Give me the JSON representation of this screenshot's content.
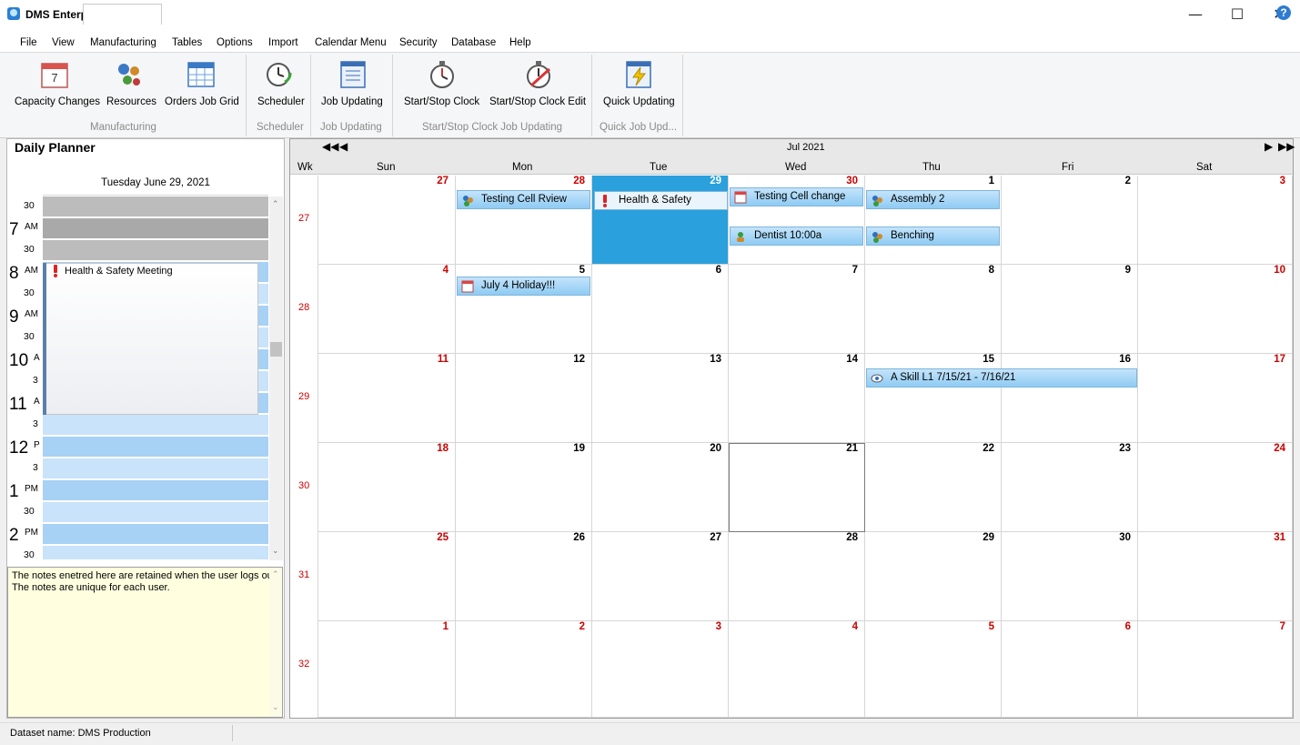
{
  "app": {
    "title": "DMS Enterprise",
    "window_controls": [
      "minimize",
      "maximize",
      "close"
    ]
  },
  "menu": {
    "items": [
      "File",
      "View",
      "Manufacturing",
      "Tables",
      "Options",
      "Import",
      "Calendar Menu",
      "Security",
      "Database",
      "Help"
    ],
    "active": "Manufacturing"
  },
  "ribbon": {
    "buttons": [
      {
        "label": "Capacity Changes",
        "icon": "calendar-icon"
      },
      {
        "label": "Resources",
        "icon": "resources-icon"
      },
      {
        "label": "Orders Job Grid",
        "icon": "grid-icon"
      },
      {
        "label": "Scheduler",
        "icon": "clock-refresh-icon"
      },
      {
        "label": "Job Updating",
        "icon": "document-icon"
      },
      {
        "label": "Start/Stop Clock",
        "icon": "stopwatch-icon"
      },
      {
        "label": "Start/Stop Clock Edit",
        "icon": "stopwatch-edit-icon"
      },
      {
        "label": "Quick Updating",
        "icon": "quick-update-icon"
      }
    ],
    "groups": [
      "Manufacturing",
      "Scheduler",
      "Job Updating",
      "Start/Stop Clock Job Updating",
      "Quick Job Upd..."
    ]
  },
  "planner": {
    "title": "Daily Planner",
    "date": "Tuesday June 29, 2021",
    "half_label": "30",
    "hours": [
      {
        "hour": "7",
        "suffix": "AM"
      },
      {
        "hour": "8",
        "suffix": "AM"
      },
      {
        "hour": "9",
        "suffix": "AM"
      },
      {
        "hour": "10",
        "suffix": "A"
      },
      {
        "hour": "11",
        "suffix": "A"
      },
      {
        "hour": "12",
        "suffix": "P"
      },
      {
        "hour": "1",
        "suffix": "PM"
      },
      {
        "hour": "2",
        "suffix": "PM"
      }
    ],
    "half_labels_short": "3",
    "appointment": "Health & Safety Meeting",
    "notes": "The notes enetred here are retained when the user logs out.  The notes are unique for each user."
  },
  "calendar": {
    "month": "Jul 2021",
    "wk_header": "Wk",
    "days": [
      "Sun",
      "Mon",
      "Tue",
      "Wed",
      "Thu",
      "Fri",
      "Sat"
    ],
    "weeks": [
      {
        "wk": "27",
        "dates": [
          "27",
          "28",
          "29",
          "30",
          "1",
          "2",
          "3"
        ]
      },
      {
        "wk": "28",
        "dates": [
          "4",
          "5",
          "6",
          "7",
          "8",
          "9",
          "10"
        ]
      },
      {
        "wk": "29",
        "dates": [
          "11",
          "12",
          "13",
          "14",
          "15",
          "16",
          "17"
        ]
      },
      {
        "wk": "30",
        "dates": [
          "18",
          "19",
          "20",
          "21",
          "22",
          "23",
          "24"
        ]
      },
      {
        "wk": "31",
        "dates": [
          "25",
          "26",
          "27",
          "28",
          "29",
          "30",
          "31"
        ]
      },
      {
        "wk": "32",
        "dates": [
          "1",
          "2",
          "3",
          "4",
          "5",
          "6",
          "7"
        ]
      }
    ],
    "events": [
      {
        "label": "Testing Cell Rview",
        "icon": "people-icon"
      },
      {
        "label": "Health & Safety",
        "icon": "exclamation-icon"
      },
      {
        "label": "Testing Cell change",
        "icon": "calendar-icon"
      },
      {
        "label": "Assembly 2",
        "icon": "people-icon"
      },
      {
        "label": "Dentist 10:00a",
        "icon": "person-icon"
      },
      {
        "label": "Benching",
        "icon": "people-icon"
      },
      {
        "label": "July 4 Holiday!!!",
        "icon": "calendar-icon"
      },
      {
        "label": "A Skill L1  7/15/21 - 7/16/21",
        "icon": "eye-icon"
      }
    ],
    "colors": {
      "today": "#2aa0dc",
      "weekend_date": "#cc0000",
      "event": "#9fd3f6"
    }
  },
  "status": {
    "text": "Dataset name:  DMS Production"
  }
}
